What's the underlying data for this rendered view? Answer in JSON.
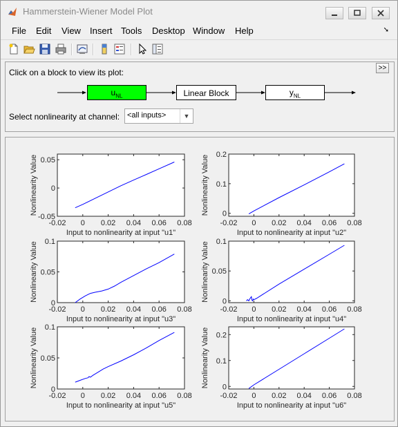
{
  "window": {
    "title": "Hammerstein-Wiener Model Plot"
  },
  "menu": [
    "File",
    "Edit",
    "View",
    "Insert",
    "Tools",
    "Desktop",
    "Window",
    "Help"
  ],
  "panel": {
    "instruction": "Click on a block to view its plot:",
    "toggle_label": ">>",
    "blocks": {
      "input_nl": "u",
      "input_nl_sub": "NL",
      "linear": "Linear Block",
      "output_nl": "y",
      "output_nl_sub": "NL"
    },
    "channel_label": "Select nonlinearity at channel:",
    "channel_value": "<all inputs>"
  },
  "colors": {
    "input_block_active": "#00ff00",
    "curve": "#0000ff"
  },
  "chart_data": [
    {
      "type": "line",
      "ylabel": "Nonlinearity Value",
      "xlabel": "Input to nonlinearity at input \"u1\"",
      "xlim": [
        -0.02,
        0.08
      ],
      "ylim": [
        -0.05,
        0.06
      ],
      "xticks": [
        "-0.02",
        "0",
        "0.02",
        "0.04",
        "0.06",
        "0.08"
      ],
      "yticks": [
        "-0.05",
        "0",
        "0.05"
      ],
      "x": [
        -0.006,
        0.0,
        0.01,
        0.02,
        0.03,
        0.04,
        0.05,
        0.06,
        0.072
      ],
      "y": [
        -0.035,
        -0.029,
        -0.018,
        -0.007,
        0.004,
        0.014,
        0.024,
        0.034,
        0.046
      ]
    },
    {
      "type": "line",
      "ylabel": "Nonlinearity Value",
      "xlabel": "Input to nonlinearity at input \"u2\"",
      "xlim": [
        -0.02,
        0.08
      ],
      "ylim": [
        -0.01,
        0.2
      ],
      "xticks": [
        "-0.02",
        "0",
        "0.02",
        "0.04",
        "0.06",
        "0.08"
      ],
      "yticks": [
        "0",
        "0.1",
        "0.2"
      ],
      "x": [
        -0.004,
        0.0,
        0.02,
        0.04,
        0.06,
        0.072
      ],
      "y": [
        -0.002,
        0.008,
        0.053,
        0.096,
        0.14,
        0.167
      ]
    },
    {
      "type": "line",
      "ylabel": "Nonlinearity Value",
      "xlabel": "Input to nonlinearity at input \"u3\"",
      "xlim": [
        -0.02,
        0.08
      ],
      "ylim": [
        0,
        0.1
      ],
      "xticks": [
        "-0.02",
        "0",
        "0.02",
        "0.04",
        "0.06",
        "0.08"
      ],
      "yticks": [
        "0",
        "0.05",
        "0.1"
      ],
      "x": [
        -0.006,
        -0.002,
        0.002,
        0.006,
        0.01,
        0.015,
        0.02,
        0.025,
        0.03,
        0.04,
        0.05,
        0.06,
        0.072
      ],
      "y": [
        0.0,
        0.006,
        0.011,
        0.015,
        0.017,
        0.019,
        0.022,
        0.027,
        0.033,
        0.044,
        0.055,
        0.065,
        0.079
      ]
    },
    {
      "type": "line",
      "ylabel": "Nonlinearity Value",
      "xlabel": "Input to nonlinearity at input \"u4\"",
      "xlim": [
        -0.02,
        0.08
      ],
      "ylim": [
        -0.003,
        0.1
      ],
      "xticks": [
        "-0.02",
        "0",
        "0.02",
        "0.04",
        "0.06",
        "0.08"
      ],
      "yticks": [
        "0",
        "0.05",
        "0.1"
      ],
      "x": [
        -0.006,
        -0.005,
        -0.004,
        -0.003,
        -0.002,
        -0.0015,
        -0.001,
        -0.0005,
        0.0,
        0.002,
        0.02,
        0.04,
        0.06,
        0.072
      ],
      "y": [
        0.0,
        0.002,
        0.0,
        0.004,
        0.007,
        0.001,
        0.0,
        0.003,
        0.002,
        0.004,
        0.028,
        0.053,
        0.078,
        0.093
      ]
    },
    {
      "type": "line",
      "ylabel": "Nonlinearity Value",
      "xlabel": "Input to nonlinearity at input \"u5\"",
      "xlim": [
        -0.02,
        0.08
      ],
      "ylim": [
        0,
        0.1
      ],
      "xticks": [
        "-0.02",
        "0",
        "0.02",
        "0.04",
        "0.06",
        "0.08"
      ],
      "yticks": [
        "0",
        "0.05",
        "0.1"
      ],
      "x": [
        -0.006,
        -0.002,
        0.002,
        0.004,
        0.005,
        0.006,
        0.008,
        0.012,
        0.016,
        0.02,
        0.03,
        0.04,
        0.05,
        0.06,
        0.072
      ],
      "y": [
        0.011,
        0.014,
        0.017,
        0.018,
        0.02,
        0.019,
        0.022,
        0.027,
        0.032,
        0.036,
        0.045,
        0.055,
        0.066,
        0.078,
        0.091
      ]
    },
    {
      "type": "line",
      "ylabel": "Nonlinearity Value",
      "xlabel": "Input to nonlinearity at input \"u6\"",
      "xlim": [
        -0.02,
        0.08
      ],
      "ylim": [
        -0.01,
        0.23
      ],
      "xticks": [
        "-0.02",
        "0",
        "0.02",
        "0.04",
        "0.06",
        "0.08"
      ],
      "yticks": [
        "0",
        "0.1",
        "0.2"
      ],
      "x": [
        -0.004,
        0.0,
        0.02,
        0.04,
        0.06,
        0.072
      ],
      "y": [
        -0.008,
        0.006,
        0.066,
        0.126,
        0.186,
        0.222
      ]
    }
  ]
}
